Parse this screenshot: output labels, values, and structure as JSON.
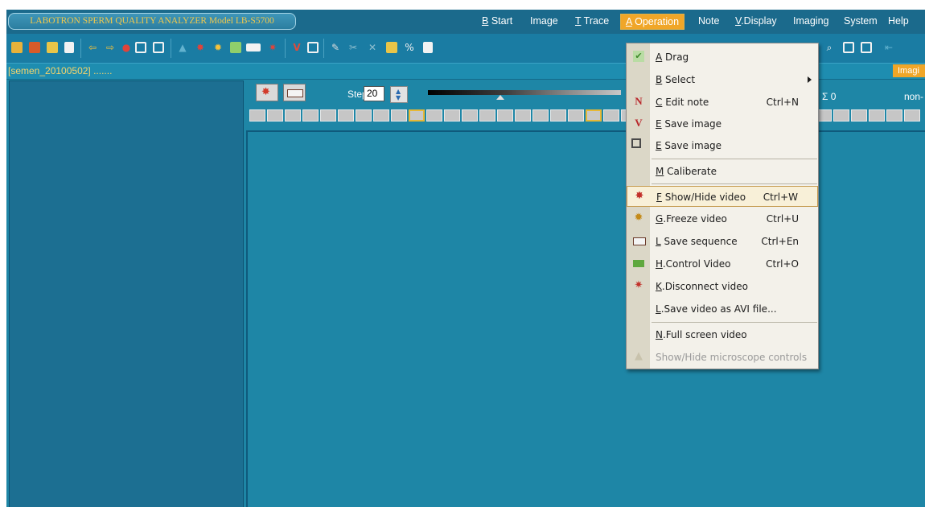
{
  "app": {
    "title": "LABOTRON SPERM QUALITY ANALYZER Model LB-S5700"
  },
  "menubar": {
    "items": [
      {
        "key": "B",
        "label": " Start"
      },
      {
        "key": "",
        "label": "Image"
      },
      {
        "key": "T",
        "label": " Trace"
      },
      {
        "key": "A",
        "label": " Operation"
      },
      {
        "key": "",
        "label": "Note"
      },
      {
        "key": "V",
        "label": ".Display"
      },
      {
        "key": "",
        "label": "Imaging"
      },
      {
        "key": "",
        "label": "System"
      },
      {
        "key": "",
        "label": "Help"
      }
    ]
  },
  "pathbar": {
    "path": "[semen_20100502] .......",
    "imaging_tab": "Imagi"
  },
  "video_header": {
    "step_label": "Step",
    "step_value": "20",
    "sigma_text": "Σ 0",
    "non_text": "non-"
  },
  "operation_menu": {
    "items": [
      {
        "key": "A",
        "label": " Drag",
        "shortcut": "",
        "icon": "checkmark-icon",
        "submenu": false,
        "disabled": false
      },
      {
        "key": "B",
        "label": " Select",
        "shortcut": "",
        "icon": "",
        "submenu": true,
        "disabled": false
      },
      {
        "key": "C",
        "label": " Edit note",
        "shortcut": "Ctrl+N",
        "icon": "note-n-icon",
        "submenu": false,
        "disabled": false
      },
      {
        "key": "E",
        "label": " Save image",
        "shortcut": "",
        "icon": "v-save-icon",
        "submenu": false,
        "disabled": false
      },
      {
        "key": "E",
        "label": " Save image",
        "shortcut": "",
        "icon": "save-frame-icon",
        "submenu": false,
        "disabled": false
      },
      {
        "key": "M",
        "label": " Caliberate",
        "shortcut": "",
        "icon": "",
        "submenu": false,
        "disabled": false
      },
      {
        "key": "F",
        "label": " Show/Hide video",
        "shortcut": "Ctrl+W",
        "icon": "video-camera-icon",
        "submenu": false,
        "disabled": false
      },
      {
        "key": "G",
        "label": ".Freeze video",
        "shortcut": "Ctrl+U",
        "icon": "freeze-video-icon",
        "submenu": false,
        "disabled": false
      },
      {
        "key": "L",
        "label": " Save sequence",
        "shortcut": "Ctrl+En",
        "icon": "film-strip-icon",
        "submenu": false,
        "disabled": false
      },
      {
        "key": "H",
        "label": ".Control Video",
        "shortcut": "Ctrl+O",
        "icon": "video-control-icon",
        "submenu": false,
        "disabled": false
      },
      {
        "key": "K",
        "label": ".Disconnect video",
        "shortcut": "",
        "icon": "disconnect-video-icon",
        "submenu": false,
        "disabled": false
      },
      {
        "key": "L",
        "label": ".Save video as AVI file...",
        "shortcut": "",
        "icon": "",
        "submenu": false,
        "disabled": false
      },
      {
        "key": "N",
        "label": ".Full screen video",
        "shortcut": "",
        "icon": "",
        "submenu": false,
        "disabled": false
      },
      {
        "key": "",
        "label": "Show/Hide microscope controls",
        "shortcut": "",
        "icon": "microscope-icon",
        "submenu": false,
        "disabled": true
      }
    ]
  },
  "colors": {
    "app_bg": "#1e86a6",
    "accent": "#f0a628",
    "title_text": "#f2c84a",
    "path_text": "#f7d46b"
  }
}
